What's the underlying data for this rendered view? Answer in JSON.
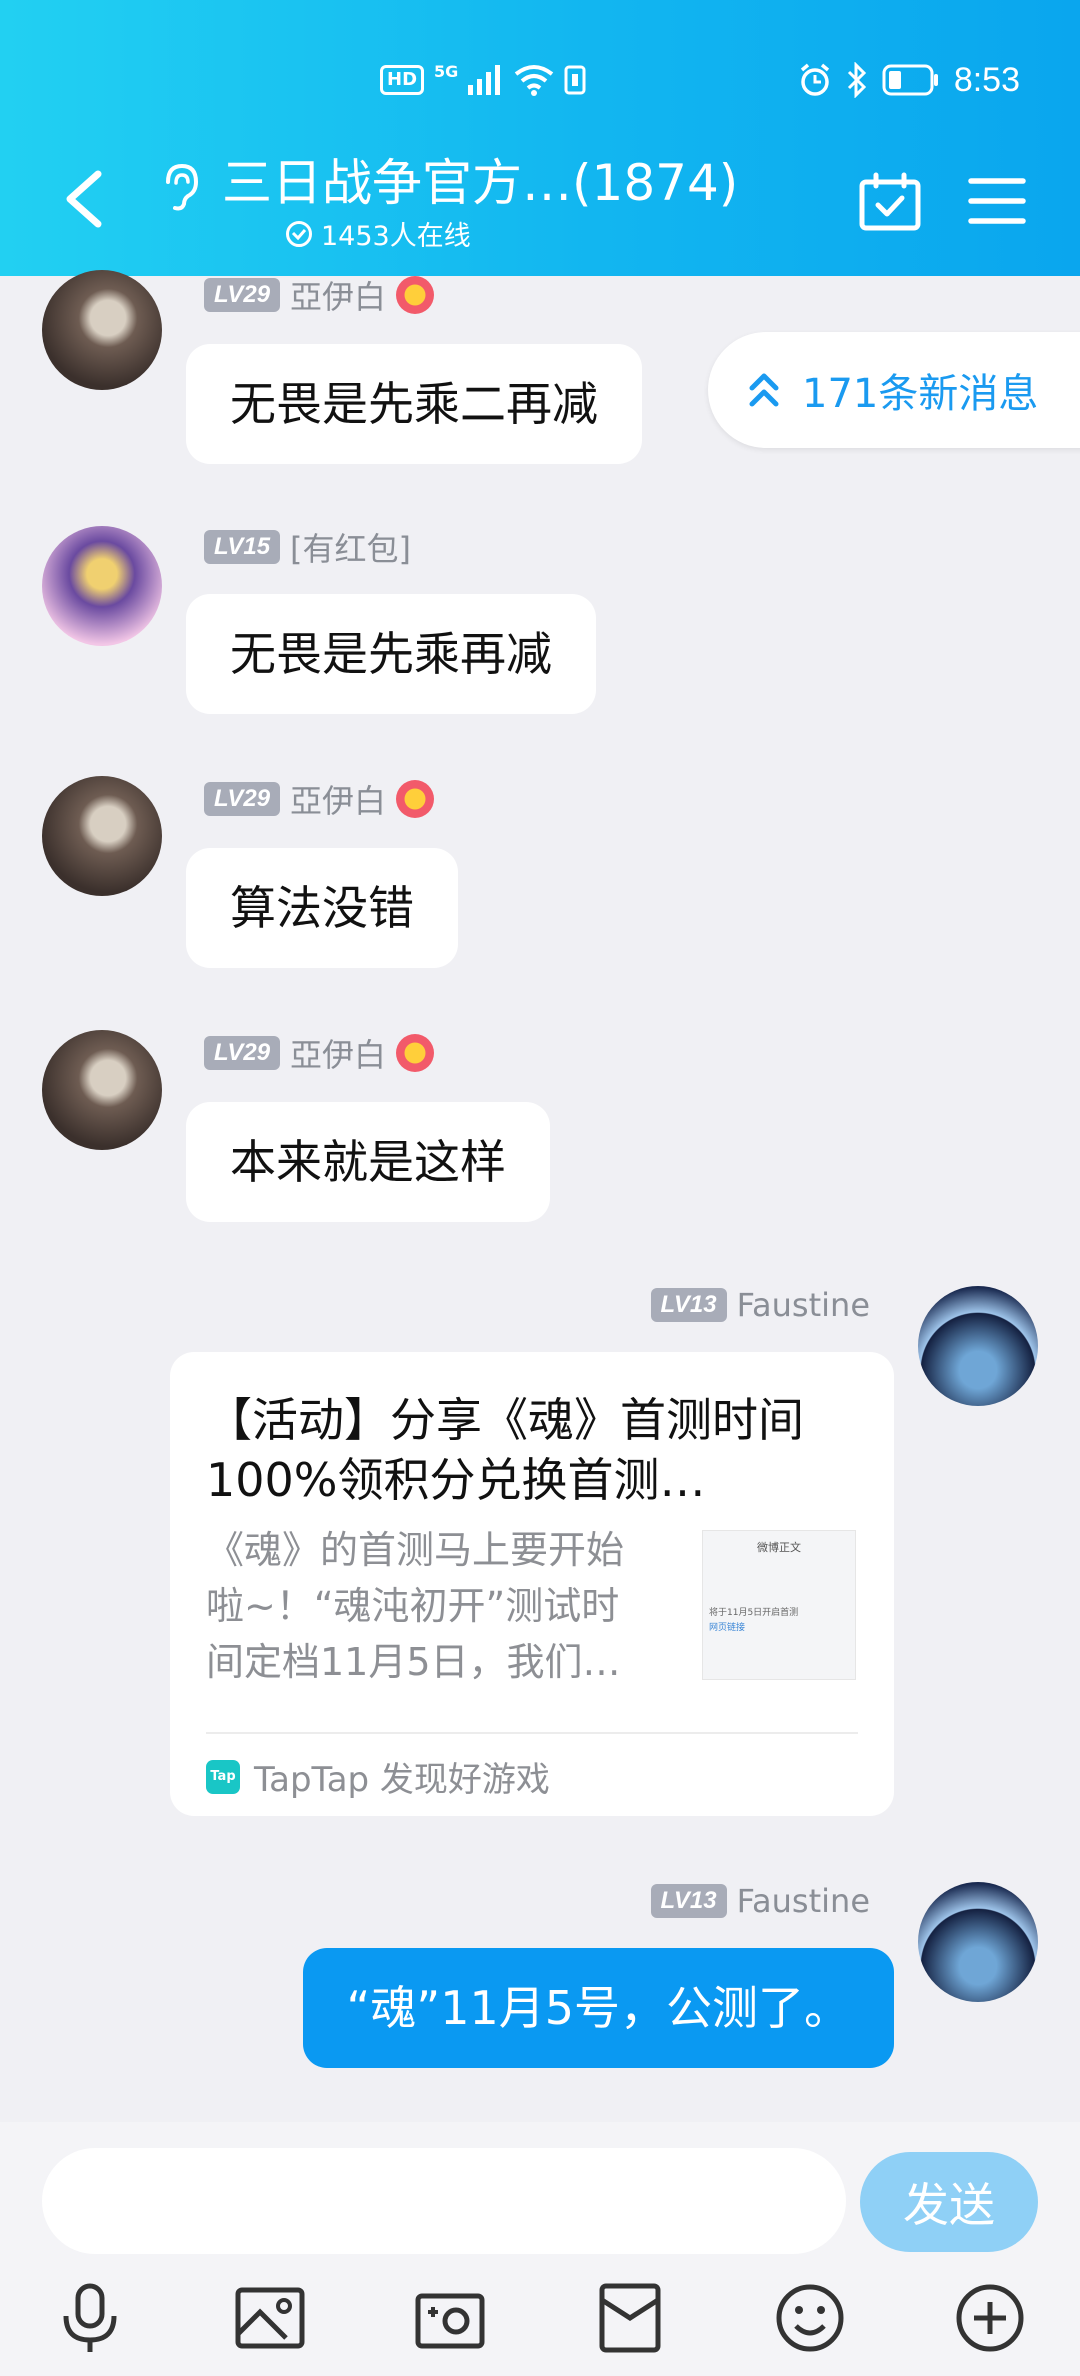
{
  "status_bar": {
    "hd_label": "HD",
    "network_label": "5G",
    "time": "8:53"
  },
  "header": {
    "title": "三日战争官方…(1874)",
    "online_count": "1453人在线"
  },
  "new_messages_pill": {
    "label": "171条新消息"
  },
  "messages": [
    {
      "level": "LV29",
      "name": "亞伊白",
      "text": "无畏是先乘二再减"
    },
    {
      "level": "LV15",
      "name": "[有红包]",
      "text": "无畏是先乘再减"
    },
    {
      "level": "LV29",
      "name": "亞伊白",
      "text": "算法没错"
    },
    {
      "level": "LV29",
      "name": "亞伊白",
      "text": "本来就是这样"
    },
    {
      "level": "LV13",
      "name": "Faustine",
      "card": {
        "title": "【活动】分享《魂》首测时间 100%领积分兑换首测…",
        "description": "《魂》的首测马上要开始啦~！“魂沌初开”测试时间定档11月5日，我们…",
        "thumb_title": "微博正文",
        "thumb_caption": "将于11月5日开启首测",
        "thumb_link": "网页链接",
        "source": "TapTap 发现好游戏",
        "source_icon_label": "Tap"
      }
    },
    {
      "level": "LV13",
      "name": "Faustine",
      "text": "“魂”11月5号，公测了。"
    }
  ],
  "input": {
    "value": "",
    "send_label": "发送"
  },
  "toolbar": {
    "icons": [
      "microphone-icon",
      "image-icon",
      "camera-icon",
      "red-packet-icon",
      "emoji-icon",
      "plus-icon"
    ]
  },
  "colors": {
    "header_start": "#22d0f2",
    "header_end": "#0aa6ee",
    "accent_blue": "#0a99f2",
    "send_button": "#8fd0f6",
    "background": "#f0f0f4"
  }
}
